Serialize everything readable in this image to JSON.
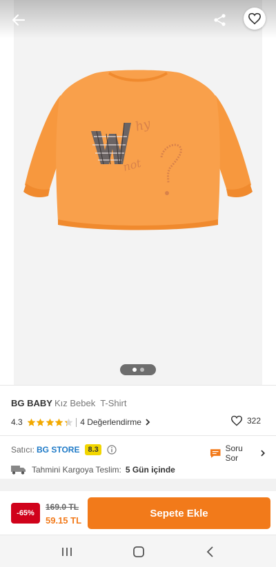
{
  "header": {
    "back_icon": "arrow-left-icon",
    "share_icon": "share-icon",
    "favorite_icon": "heart-icon"
  },
  "gallery": {
    "image_alt": "orange sweatshirt",
    "print_text": "Why not?",
    "page_count": 2,
    "active_page": 1
  },
  "product": {
    "brand": "BG BABY",
    "category": "Kız Bebek  T-Shirt",
    "rating": "4.3",
    "rating_value": 4.3,
    "reviews_label": "4 Değerlendirme",
    "likes": "322"
  },
  "seller": {
    "label": "Satıcı:",
    "name": "BG STORE",
    "score": "8.3",
    "ask_label": "Soru Sor"
  },
  "shipping": {
    "label": "Tahmini Kargoya Teslim:",
    "value": "5 Gün içinde"
  },
  "buy": {
    "discount": "-65%",
    "old_price": "169.0 TL",
    "new_price": "59.15 TL",
    "cart_label": "Sepete Ekle"
  },
  "colors": {
    "brand_orange": "#f27a1a",
    "discount_red": "#d0021b",
    "star_yellow": "#f2a900",
    "seller_blue": "#1e7ac7",
    "score_yellow": "#f2d600"
  }
}
